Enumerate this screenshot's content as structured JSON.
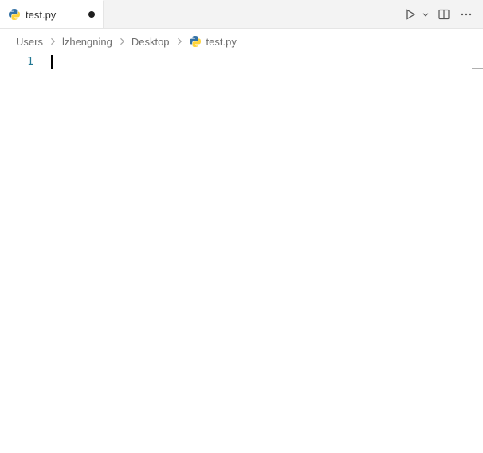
{
  "tab": {
    "label": "test.py",
    "dirty": true
  },
  "breadcrumbs": {
    "segments": [
      "Users",
      "lzhengning",
      "Desktop"
    ],
    "file": "test.py"
  },
  "editor": {
    "line_numbers": [
      "1"
    ],
    "lines": [
      ""
    ]
  }
}
